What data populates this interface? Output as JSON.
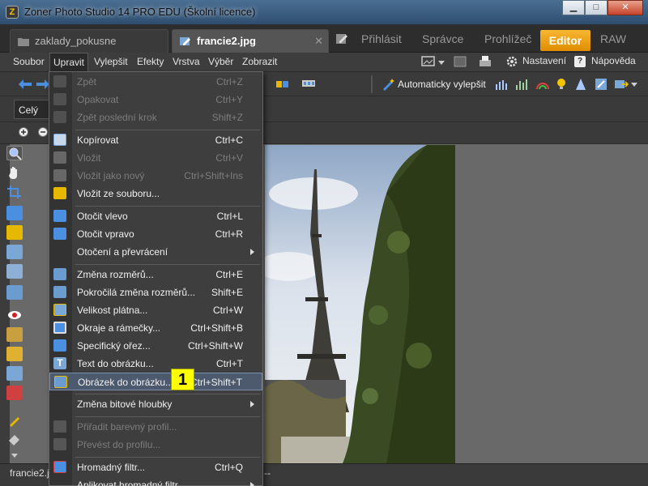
{
  "window": {
    "title": "Zoner Photo Studio 14 PRO EDU (Školní licence)",
    "app_icon_letter": "Z",
    "minimize": "▁",
    "maximize": "□",
    "close": "✕"
  },
  "tabs": {
    "doc1": "zaklady_pokusne",
    "doc2": "francie2.jpg",
    "close_glyph": "✕"
  },
  "modes": [
    "Přihlásit",
    "Správce",
    "Prohlížeč",
    "Editor",
    "RAW"
  ],
  "menubar": {
    "items": [
      "Soubor",
      "Upravit",
      "Vylepšit",
      "Efekty",
      "Vrstva",
      "Výběr",
      "Zobrazit"
    ],
    "settings": "Nastavení",
    "help": "Nápověda",
    "help_badge": "?"
  },
  "toolbar": {
    "auto_enhance": "Automaticky vylepšit",
    "zoom_value": "Celý"
  },
  "status": {
    "filename": "francie2.jpg",
    "dashes": "--"
  },
  "dropdown": {
    "items": [
      {
        "label": "Zpět",
        "shortcut": "Ctrl+Z",
        "disabled": true
      },
      {
        "label": "Opakovat",
        "shortcut": "Ctrl+Y",
        "disabled": true
      },
      {
        "label": "Zpět poslední krok",
        "shortcut": "Shift+Z",
        "disabled": true
      },
      {
        "label": "Kopírovat",
        "shortcut": "Ctrl+C",
        "disabled": false
      },
      {
        "label": "Vložit",
        "shortcut": "Ctrl+V",
        "disabled": true
      },
      {
        "label": "Vložit jako nový",
        "shortcut": "Ctrl+Shift+Ins",
        "disabled": true
      },
      {
        "label": "Vložit ze souboru...",
        "shortcut": "",
        "disabled": false
      },
      {
        "label": "Otočit vlevo",
        "shortcut": "Ctrl+L",
        "disabled": false
      },
      {
        "label": "Otočit vpravo",
        "shortcut": "Ctrl+R",
        "disabled": false
      },
      {
        "label": "Otočení a převrácení",
        "shortcut": "",
        "disabled": false
      },
      {
        "label": "Změna rozměrů...",
        "shortcut": "Ctrl+E",
        "disabled": false
      },
      {
        "label": "Pokročilá změna rozměrů...",
        "shortcut": "Shift+E",
        "disabled": false
      },
      {
        "label": "Velikost plátna...",
        "shortcut": "Ctrl+W",
        "disabled": false
      },
      {
        "label": "Okraje a rámečky...",
        "shortcut": "Ctrl+Shift+B",
        "disabled": false
      },
      {
        "label": "Specifický ořez...",
        "shortcut": "Ctrl+Shift+W",
        "disabled": false
      },
      {
        "label": "Text do obrázku...",
        "shortcut": "Ctrl+T",
        "disabled": false
      },
      {
        "label": "Obrázek do obrázku...",
        "shortcut": "Ctrl+Shift+T",
        "disabled": false
      },
      {
        "label": "Změna bitové hloubky",
        "shortcut": "",
        "disabled": false
      },
      {
        "label": "Přiřadit barevný profil...",
        "shortcut": "",
        "disabled": true
      },
      {
        "label": "Převést do profilu...",
        "shortcut": "",
        "disabled": true
      },
      {
        "label": "Hromadný filtr...",
        "shortcut": "Ctrl+Q",
        "disabled": false
      },
      {
        "label": "Aplikovat hromadný filtr",
        "shortcut": "",
        "disabled": false
      }
    ]
  },
  "callout_label": "1"
}
